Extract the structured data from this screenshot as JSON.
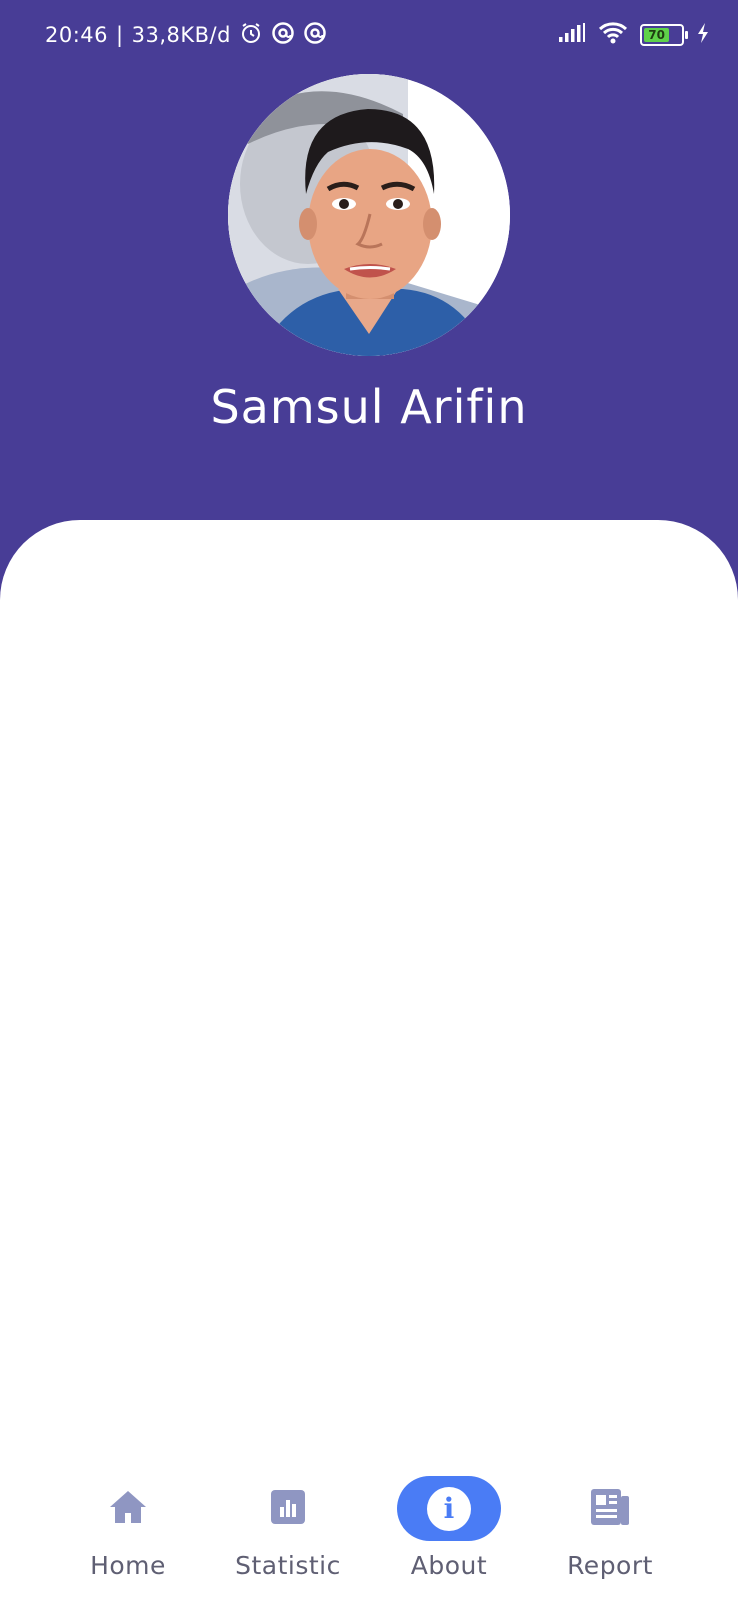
{
  "status_bar": {
    "time": "20:46",
    "separator": "|",
    "network_speed": "33,8KB/d",
    "icons": [
      "alarm-icon",
      "at-sign-icon",
      "at-sign-icon",
      "signal-icon",
      "wifi-icon",
      "battery-icon",
      "charging-icon"
    ],
    "battery_level": "70"
  },
  "profile": {
    "name": "Samsul Arifin",
    "avatar_icon": "profile-photo"
  },
  "colors": {
    "header_bg": "#483d96",
    "active_nav": "#4a7cf5",
    "inactive_icon": "#8f96c2",
    "battery_fill": "#5fd14a"
  },
  "nav": {
    "items": [
      {
        "label": "Home",
        "icon": "home-icon",
        "active": false
      },
      {
        "label": "Statistic",
        "icon": "bar-chart-icon",
        "active": false
      },
      {
        "label": "About",
        "icon": "info-icon",
        "active": true
      },
      {
        "label": "Report",
        "icon": "newspaper-icon",
        "active": false
      }
    ]
  }
}
